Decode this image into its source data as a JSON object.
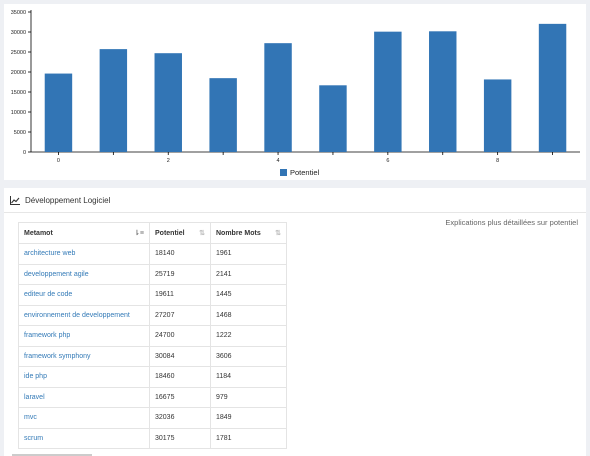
{
  "chart_data": {
    "type": "bar",
    "categories": [
      "0",
      "1",
      "2",
      "3",
      "4",
      "5",
      "6",
      "7",
      "8",
      "9"
    ],
    "values": [
      19611,
      25719,
      24700,
      18460,
      27207,
      16675,
      30084,
      30175,
      18140,
      32036
    ],
    "y_ticks": [
      "0",
      "5000",
      "10000",
      "15000",
      "20000",
      "25000",
      "30000",
      "35000"
    ],
    "x_tick_labels": [
      "0",
      "2",
      "4",
      "6",
      "8"
    ],
    "ylim": [
      0,
      35000
    ],
    "legend": [
      "Potentiel"
    ],
    "legend_placement": "bottom",
    "color": "#3275b5"
  },
  "section": {
    "title": "Développement Logiciel",
    "icon": "line-chart-icon",
    "explanation": "Explications plus détaillées sur potentiel"
  },
  "table": {
    "headers": [
      "Metamot",
      "Potentiel",
      "Nombre Mots"
    ],
    "rows": [
      [
        "architecture web",
        "18140",
        "1961"
      ],
      [
        "developpement agile",
        "25719",
        "2141"
      ],
      [
        "editeur de code",
        "19611",
        "1445"
      ],
      [
        "environnement de developpement",
        "27207",
        "1468"
      ],
      [
        "framework php",
        "24700",
        "1222"
      ],
      [
        "framework symphony",
        "30084",
        "3606"
      ],
      [
        "ide php",
        "18460",
        "1184"
      ],
      [
        "laravel",
        "16675",
        "979"
      ],
      [
        "mvc",
        "32036",
        "1849"
      ],
      [
        "scrum",
        "30175",
        "1781"
      ]
    ]
  }
}
